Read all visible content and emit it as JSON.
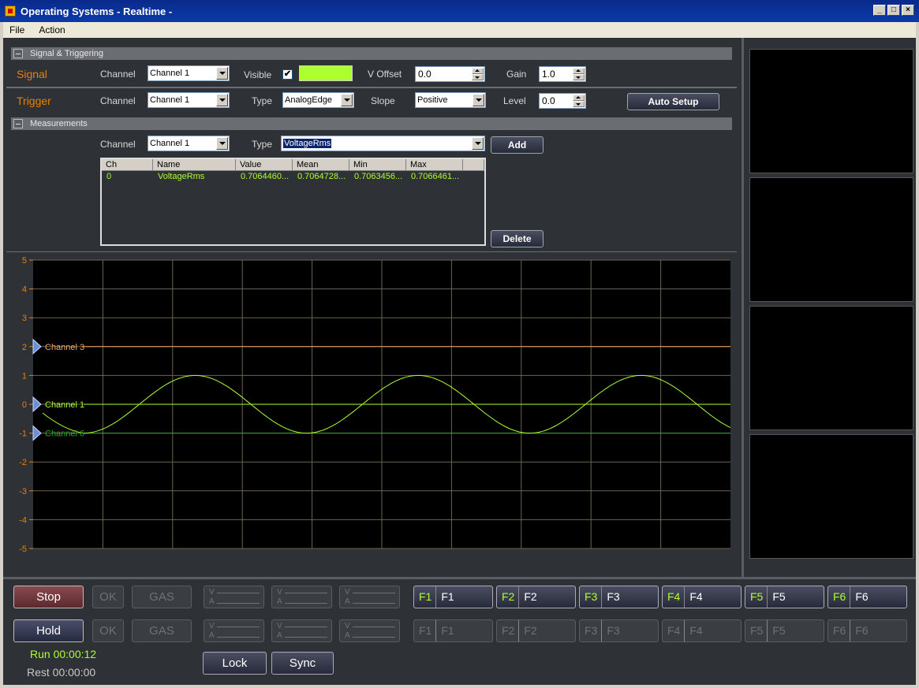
{
  "window": {
    "title": "Operating Systems - Realtime -"
  },
  "menu": {
    "file": "File",
    "action": "Action"
  },
  "signal_section": {
    "header": "Signal & Triggering",
    "signal_label": "Signal",
    "channel_label": "Channel",
    "channel_value": "Channel 1",
    "visible_label": "Visible",
    "visible_checked": "✔",
    "color": "#adff2f",
    "voffset_label": "V Offset",
    "voffset_value": "0.0",
    "gain_label": "Gain",
    "gain_value": "1.0"
  },
  "trigger_section": {
    "trigger_label": "Trigger",
    "channel_label": "Channel",
    "channel_value": "Channel 1",
    "type_label": "Type",
    "type_value": "AnalogEdge",
    "slope_label": "Slope",
    "slope_value": "Positive",
    "level_label": "Level",
    "level_value": "0.0",
    "auto_setup": "Auto Setup"
  },
  "measurements": {
    "header": "Measurements",
    "channel_label": "Channel",
    "channel_value": "Channel 1",
    "type_label": "Type",
    "type_value": "VoltageRms",
    "add": "Add",
    "delete": "Delete",
    "columns": [
      "Ch",
      "Name",
      "Value",
      "Mean",
      "Min",
      "Max"
    ],
    "rows": [
      [
        "0",
        "VoltageRms",
        "0.7064460...",
        "0.7064728...",
        "0.7063456...",
        "0.7066461..."
      ]
    ]
  },
  "scope": {
    "y_ticks": [
      "5",
      "4",
      "3",
      "2",
      "1",
      "0",
      "-1",
      "-2",
      "-3",
      "-4",
      "-5"
    ],
    "ylim": [
      -5,
      5
    ],
    "markers": [
      {
        "label": "Channel 3",
        "level": 2,
        "color": "#f4a460"
      },
      {
        "label": "Channel 1",
        "level": 0,
        "color": "#adff2f"
      },
      {
        "label": "Channel 6",
        "level": -1,
        "color": "#2aa52a"
      }
    ],
    "sine": {
      "amplitude": 1,
      "cycles": 2.9,
      "color": "#adff2f"
    }
  },
  "controls": {
    "stop": "Stop",
    "hold": "Hold",
    "ok": "OK",
    "gas": "GAS",
    "v": "V",
    "a": "A",
    "lock": "Lock",
    "sync": "Sync",
    "run_status": "Run 00:00:12",
    "rest_status": "Rest 00:00:00",
    "fkeys_top": [
      {
        "key": "F1",
        "name": "F1"
      },
      {
        "key": "F2",
        "name": "F2"
      },
      {
        "key": "F3",
        "name": "F3"
      },
      {
        "key": "F4",
        "name": "F4"
      },
      {
        "key": "F5",
        "name": "F5"
      },
      {
        "key": "F6",
        "name": "F6"
      }
    ],
    "fkeys_bottom": [
      {
        "key": "F1",
        "name": "F1"
      },
      {
        "key": "F2",
        "name": "F2"
      },
      {
        "key": "F3",
        "name": "F3"
      },
      {
        "key": "F4",
        "name": "F4"
      },
      {
        "key": "F5",
        "name": "F5"
      },
      {
        "key": "F6",
        "name": "F6"
      }
    ]
  }
}
